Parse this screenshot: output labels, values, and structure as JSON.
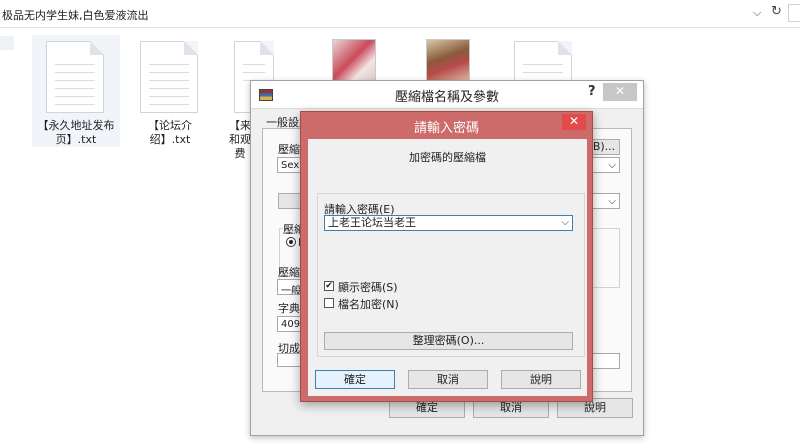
{
  "address_bar": {
    "path": "极品无内学生妹,白色爱液流出",
    "dropdown_glyph": "⌵",
    "refresh_glyph": "↻"
  },
  "files": [
    {
      "caption": "【永久地址发布页】.txt",
      "kind": "text-file-icon"
    },
    {
      "caption": "【论坛介绍】.txt",
      "kind": "text-file-icon"
    },
    {
      "caption": "【来和观费",
      "kind": "text-file-icon"
    },
    {
      "caption": "",
      "kind": "image-thumbnail"
    },
    {
      "caption": "",
      "kind": "image-thumbnail"
    },
    {
      "caption": "",
      "kind": "text-file-icon"
    }
  ],
  "archive_dialog": {
    "title": "壓縮檔名稱及參數",
    "help": "?",
    "close": "✕",
    "tab_general": "一般設定",
    "archive_name_label": "壓縮檔",
    "archive_name_value": "Sex.ra",
    "browse_button": "B)...",
    "format_group_label": "壓縮",
    "format_option": "R",
    "method_label": "壓縮方",
    "method_value": "一般",
    "dict_label": "字典檔",
    "dict_value": "4096",
    "split_label": "切成分",
    "ok_button": "確定",
    "cancel_button": "取消",
    "help_button": "說明"
  },
  "password_dialog": {
    "title": "請輸入密碼",
    "close": "✕",
    "subtitle": "加密碼的壓縮檔",
    "password_label": "請輸入密碼(E)",
    "password_value": "上老王论坛当老王",
    "show_password_label": "顯示密碼(S)",
    "show_password_checked": true,
    "encrypt_names_label": "檔名加密(N)",
    "encrypt_names_checked": false,
    "organize_button": "整理密碼(O)...",
    "ok_button": "確定",
    "cancel_button": "取消",
    "help_button": "說明",
    "check_glyph": "✔"
  }
}
